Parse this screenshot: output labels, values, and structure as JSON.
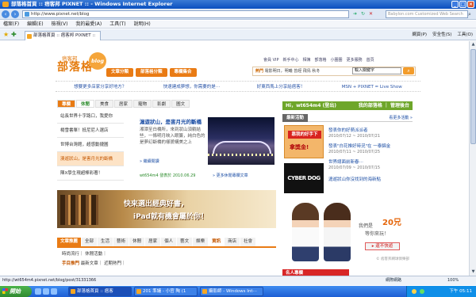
{
  "window": {
    "title": "部落格首頁 :: 痞客邦 PIXNET :: - Windows Internet Explorer"
  },
  "address": {
    "url": "http://www.pixnet.net/blog",
    "search_placeholder": "Babylon.com Customized Web Search"
  },
  "menu": [
    "檔案(F)",
    "編輯(E)",
    "檢視(V)",
    "我的最愛(A)",
    "工具(T)",
    "說明(H)"
  ],
  "favbar": {
    "tab_label": "部落格首頁 :: 痞客邦 PIXNET ::",
    "commands": [
      "網頁(P)",
      "安全性(S)",
      "工具(O)"
    ]
  },
  "site": {
    "logo_small": "痞客邦",
    "logo": "部落格",
    "logo_badge": "blog",
    "nav": [
      "文章分類",
      "部落格分類",
      "專欄集合"
    ],
    "top_links": [
      "會員 VIP",
      "新手中心",
      "相簿",
      "部落格",
      "小圈圈",
      "更多服務",
      "首頁"
    ],
    "hot_label": "熱門",
    "hot_text": "電影明日，明曦 曾經 飛鳥 秋冬",
    "search_value": "輸入關鍵字",
    "promo": [
      "想要更多店家分享好地方？",
      "快速建成夢想，你需要的是⋯",
      "好東西馬上分享給痞客！",
      "MSN + PIXNET = Live Show"
    ]
  },
  "left": {
    "tabs": [
      "專欄",
      "休閒",
      "美食",
      "居家",
      "寵物",
      "影劇",
      "圖文"
    ],
    "list": [
      "站長世界十字路口，我愛你",
      "楊雪書單！抵尼尼人選店",
      "世博台灣館，超感動捷圖",
      "澳遊狀山，是害月光的斷橋",
      "陳X學生現超棒彩著！"
    ],
    "feature_title": "滬遊狀山，是害月光的斷橋",
    "feature_text": "湘潭至白橋所，來到狀山須躺結些，一條明月映入眼簾，純白色的是夢幻斷橋的樣貌構美之上",
    "feature_more": "» 繼續閱讀",
    "feature_user": "wt654m4 發表於 2010.06.29",
    "feature_footer": "» 更多休閒專欄文章",
    "banner_line1": "快來選出經典好書，",
    "banner_line2": "iPad就有機會屬於你！",
    "bottom_tabs": [
      "文章推薦",
      "全部",
      "生活",
      "藝術",
      "休閒",
      "居家",
      "個人",
      "藝文",
      "娛樂",
      "資訊",
      "商店",
      "社會"
    ],
    "bottom_line1": "時尚流行｜ 休閒活動｜",
    "bottom_label": "手目推門",
    "bottom_line2": "最新文章｜ 近期熱門｜"
  },
  "right": {
    "user_bar": "Hi，wt654m4 (登出)",
    "user_links": "我的部落格 ｜ 管理後台",
    "section": "最新活動",
    "section_more": "看更多活動 »",
    "ad1_line1": "靠我的好手下",
    "ad1_line2": "拿獎金!",
    "ad2": "CYBER DOG",
    "news": [
      {
        "title": "發表你的好萌派派者",
        "date": "2010/07/12 ~ 2010/07/21"
      },
      {
        "title": "發表\"白花推好時況\"在 一泰錦金",
        "date": "2010/07/11 ~ 2010/07/25"
      },
      {
        "title": "世界總面前新春⋯",
        "date": "2010/07/09 ~ 2010/07/15"
      },
      {
        "title": "滬遊狀山你沒找到的海新點",
        "date": ""
      }
    ],
    "girls_t1": "我們是",
    "girls_t2": "20兄",
    "girls_t3": "等你來玩！",
    "girls_btn": "▸ 還不快遊",
    "girls_copy": "© 痞客邦網球俱樂部",
    "famous": "名人專欄"
  },
  "status": {
    "text": "http://wt654m4.pixnet.net/blog/post/31331366",
    "zone": "網際網路",
    "zoom": "100%"
  },
  "taskbar": {
    "start": "開始",
    "tasks": [
      "部落格首頁 :: 痞客",
      "201 準議 - 小官 陶 (1",
      "攝影師 - Windows Int⋯"
    ],
    "clock": "下午 05:11"
  }
}
